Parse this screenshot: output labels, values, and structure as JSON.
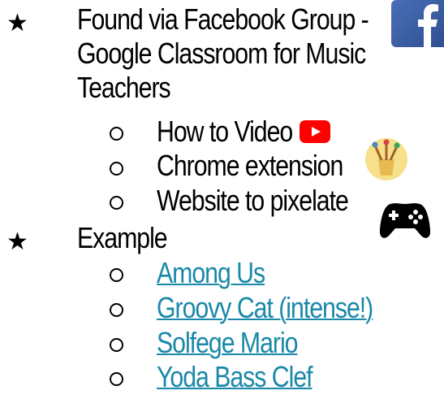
{
  "bullets": [
    {
      "star": "★",
      "lines": [
        "Found via Facebook Group -",
        "Google Classroom for Music",
        "Teachers"
      ],
      "subitems": [
        {
          "label": "How to Video",
          "icon": "youtube-icon"
        },
        {
          "label": "Chrome extension",
          "icon": "paint-brushes-icon"
        },
        {
          "label": "Website to pixelate",
          "icon": "game-controller-icon"
        }
      ]
    },
    {
      "star": "★",
      "lines": [
        "Example"
      ],
      "subitems": [
        {
          "label": "Among Us",
          "link": true
        },
        {
          "label": "Groovy Cat (intense!)",
          "link": true
        },
        {
          "label": "Solfege Mario",
          "link": true
        },
        {
          "label": "Yoda Bass Clef",
          "link": true
        }
      ]
    }
  ],
  "icons": {
    "header": "facebook-icon"
  },
  "colors": {
    "link": "#1a88a8",
    "facebook": "#3b5ea8",
    "youtube": "#ff0000"
  }
}
